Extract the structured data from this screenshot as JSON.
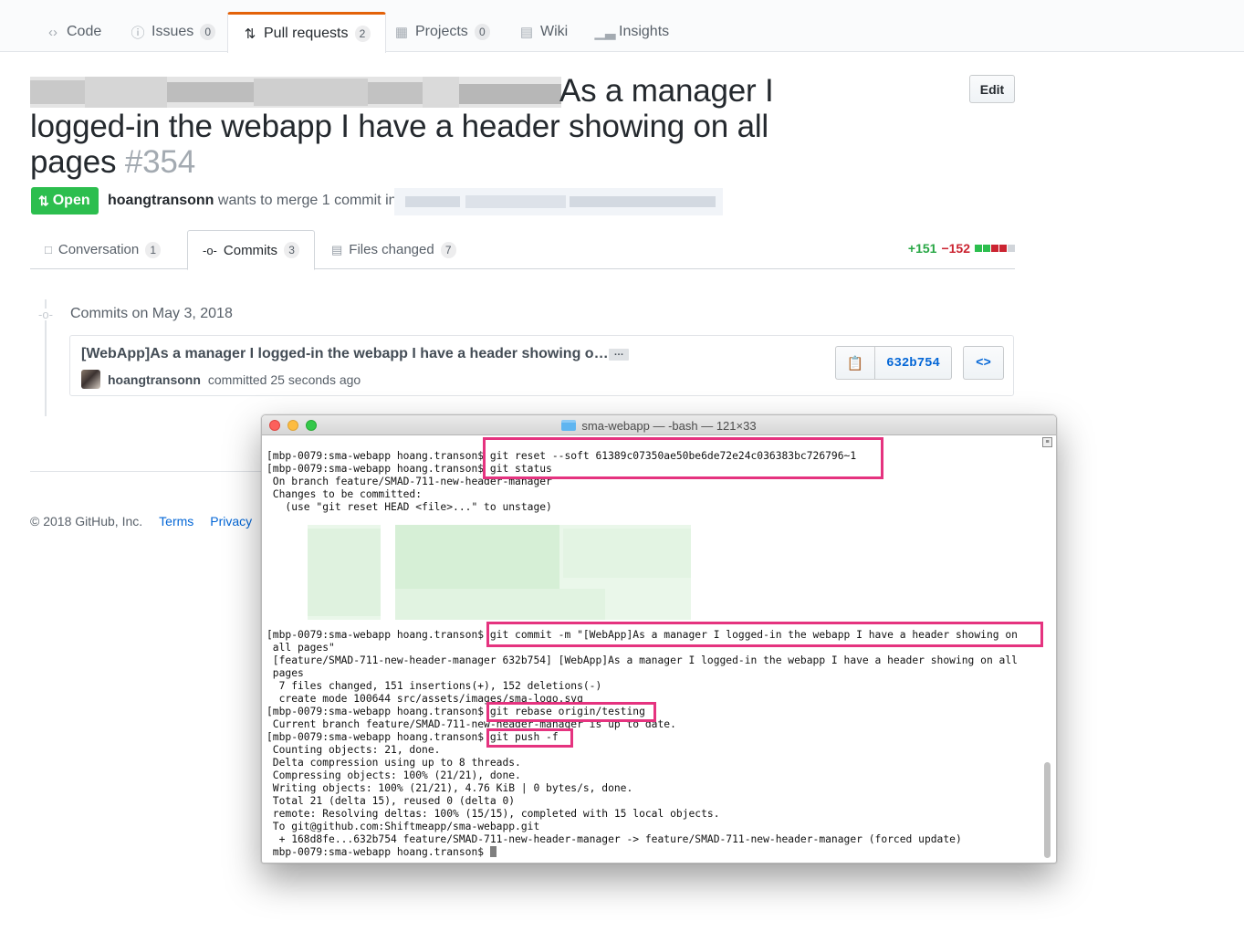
{
  "reponav": {
    "items": [
      {
        "label": "Code",
        "icon": "code-icon",
        "count": ""
      },
      {
        "label": "Issues",
        "icon": "issue-icon",
        "count": "0"
      },
      {
        "label": "Pull requests",
        "icon": "pull-request-icon",
        "count": "2"
      },
      {
        "label": "Projects",
        "icon": "project-icon",
        "count": "0"
      },
      {
        "label": "Wiki",
        "icon": "book-icon",
        "count": ""
      },
      {
        "label": "Insights",
        "icon": "graph-icon",
        "count": ""
      }
    ]
  },
  "pr": {
    "title_line1": "As a manager I",
    "title_line2": "logged-in the webapp I have a header showing on all",
    "title_line3": "pages",
    "number": "#354",
    "edit_label": "Edit",
    "state_label": "Open",
    "author": "hoangtransonn",
    "merge_text": "wants to merge 1 commit into"
  },
  "tabs": [
    {
      "label": "Conversation",
      "count": "1",
      "icon": "comment-icon"
    },
    {
      "label": "Commits",
      "count": "3",
      "icon": "commit-icon"
    },
    {
      "label": "Files changed",
      "count": "7",
      "icon": "diff-icon"
    }
  ],
  "diffstat": {
    "additions": "+151",
    "deletions": "−152"
  },
  "commits": {
    "date_heading": "Commits on May 3, 2018",
    "items": [
      {
        "title": "[WebApp]As a manager I logged-in the webapp I have a header showing o…",
        "author": "hoangtransonn",
        "meta": "committed 25 seconds ago",
        "sha": "632b754",
        "ellipsis": "…",
        "browse": "<>"
      }
    ]
  },
  "footer": {
    "copyright": "© 2018 GitHub, Inc.",
    "links": [
      "Terms",
      "Privacy"
    ]
  },
  "terminal": {
    "title": "sma-webapp — -bash — 121×33",
    "lines": [
      "[mbp-0079:sma-webapp hoang.transon$ git reset --soft 61389c07350ae50be6de72e24c036383bc726796~1",
      "[mbp-0079:sma-webapp hoang.transon$ git status",
      " On branch feature/SMAD-711-new-header-manager",
      " Changes to be committed:",
      "   (use \"git reset HEAD <file>...\" to unstage)",
      "",
      "",
      "",
      "",
      "",
      "",
      "",
      "",
      "",
      "[mbp-0079:sma-webapp hoang.transon$ git commit -m \"[WebApp]As a manager I logged-in the webapp I have a header showing on",
      " all pages\"",
      " [feature/SMAD-711-new-header-manager 632b754] [WebApp]As a manager I logged-in the webapp I have a header showing on all",
      " pages",
      "  7 files changed, 151 insertions(+), 152 deletions(-)",
      "  create mode 100644 src/assets/images/sma-logo.svg",
      "[mbp-0079:sma-webapp hoang.transon$ git rebase origin/testing",
      " Current branch feature/SMAD-711-new-header-manager is up to date.",
      "[mbp-0079:sma-webapp hoang.transon$ git push -f",
      " Counting objects: 21, done.",
      " Delta compression using up to 8 threads.",
      " Compressing objects: 100% (21/21), done.",
      " Writing objects: 100% (21/21), 4.76 KiB | 0 bytes/s, done.",
      " Total 21 (delta 15), reused 0 (delta 0)",
      " remote: Resolving deltas: 100% (15/15), completed with 15 local objects.",
      " To git@github.com:Shiftmeapp/sma-webapp.git",
      "  + 168d8fe...632b754 feature/SMAD-711-new-header-manager -> feature/SMAD-711-new-header-manager (forced update)",
      " mbp-0079:sma-webapp hoang.transon$ "
    ]
  },
  "colors": {
    "accent_orange": "#e36209",
    "open_green": "#2cbe4e",
    "link_blue": "#0366d6",
    "highlight_pink": "#e5337f"
  }
}
